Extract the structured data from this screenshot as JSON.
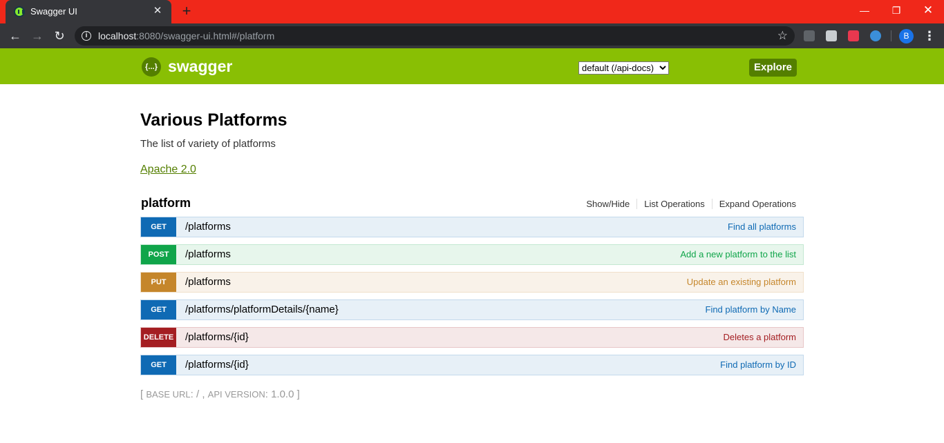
{
  "browser": {
    "tab_title": "Swagger UI",
    "tab_close": "✕",
    "new_tab": "+",
    "url_host": "localhost",
    "url_rest": ":8080/swagger-ui.html#/platform",
    "avatar_letter": "B",
    "icons": {
      "back": "back-arrow-icon",
      "forward": "forward-arrow-icon",
      "reload": "reload-icon",
      "info": "info-icon",
      "bookmark": "star-icon",
      "menu": "kebab-menu-icon"
    }
  },
  "swagger_header": {
    "brand": "swagger",
    "logo_glyph": "{...}",
    "spec_select": "default (/api-docs)",
    "explore_label": "Explore",
    "colors": {
      "bar": "#89bf04",
      "button": "#547f00"
    }
  },
  "info": {
    "title": "Various Platforms",
    "description": "The list of variety of platforms",
    "license": "Apache 2.0"
  },
  "resource": {
    "name": "platform",
    "actions": [
      "Show/Hide",
      "List Operations",
      "Expand Operations"
    ]
  },
  "operations": [
    {
      "method": "GET",
      "path": "/platforms",
      "summary": "Find all platforms"
    },
    {
      "method": "POST",
      "path": "/platforms",
      "summary": "Add a new platform to the list"
    },
    {
      "method": "PUT",
      "path": "/platforms",
      "summary": "Update an existing platform"
    },
    {
      "method": "GET",
      "path": "/platforms/platformDetails/{name}",
      "summary": "Find platform by Name"
    },
    {
      "method": "DELETE",
      "path": "/platforms/{id}",
      "summary": "Deletes a platform"
    },
    {
      "method": "GET",
      "path": "/platforms/{id}",
      "summary": "Find platform by ID"
    }
  ],
  "method_colors": {
    "GET": "#0f6ab4",
    "POST": "#10a54a",
    "PUT": "#c5862b",
    "DELETE": "#a41e22"
  },
  "footer": {
    "open": "[ ",
    "base_url_label": "BASE URL",
    "base_url_value": ": / , ",
    "api_version_label": "API VERSION",
    "api_version_value": ": 1.0.0 ]"
  }
}
